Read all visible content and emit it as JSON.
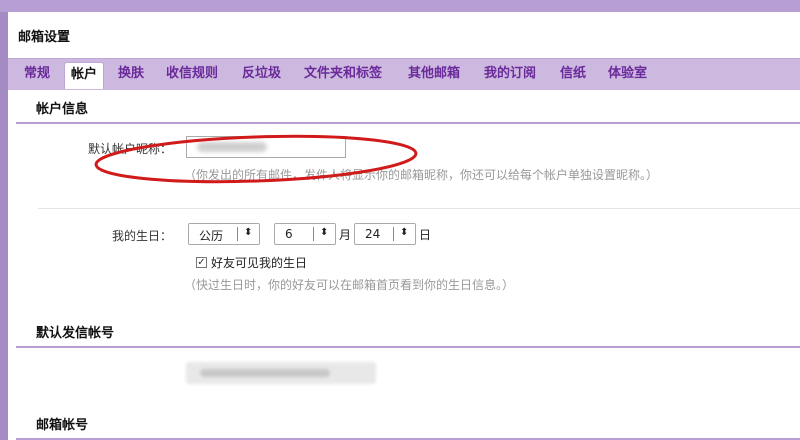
{
  "header": {
    "title": "邮箱设置"
  },
  "tabs": [
    {
      "label": "常规"
    },
    {
      "label": "帐户"
    },
    {
      "label": "换肤"
    },
    {
      "label": "收信规则"
    },
    {
      "label": "反垃圾"
    },
    {
      "label": "文件夹和标签"
    },
    {
      "label": "其他邮箱"
    },
    {
      "label": "我的订阅"
    },
    {
      "label": "信纸"
    },
    {
      "label": "体验室"
    }
  ],
  "account_info": {
    "heading": "帐户信息",
    "nickname_label": "默认帐户昵称：",
    "nickname_hint": "（你发出的所有邮件，发件人将显示你的邮箱昵称，你还可以给每个帐户单独设置昵称。）",
    "birthday_label": "我的生日：",
    "calendar_value": "公历",
    "month_value": "6",
    "month_unit": "月",
    "day_value": "24",
    "day_unit": "日",
    "friends_visible_label": "好友可见我的生日",
    "birthday_hint": "（快过生日时，你的好友可以在邮箱首页看到你的生日信息。）"
  },
  "default_sender": {
    "heading": "默认发信帐号"
  },
  "mailbox_accounts": {
    "heading": "邮箱帐号"
  },
  "colors": {
    "accent": "#b79fd4",
    "tab_text": "#6a2a9a",
    "annotation_red": "#d11a1a"
  }
}
